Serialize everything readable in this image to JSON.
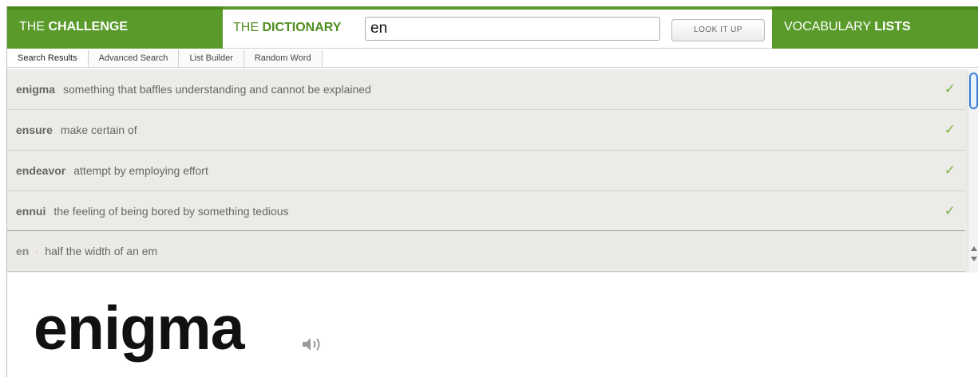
{
  "header": {
    "challenge": {
      "prefix": "THE ",
      "strong": "CHALLENGE"
    },
    "dictionary": {
      "prefix": "THE ",
      "strong": "DICTIONARY"
    },
    "search_value": "en",
    "lookup_label": "LOOK IT UP",
    "vocab": {
      "prefix": "VOCABULARY ",
      "strong": "LISTS"
    }
  },
  "tabs": [
    "Search Results",
    "Advanced Search",
    "List Builder",
    "Random Word"
  ],
  "results": [
    {
      "word": "enigma",
      "def": "something that baffles understanding and cannot be explained",
      "checked": true
    },
    {
      "word": "ensure",
      "def": "make certain of",
      "checked": true
    },
    {
      "word": "endeavor",
      "def": "attempt by employing effort",
      "checked": true
    },
    {
      "word": "ennui",
      "def": "the feeling of being bored by something tedious",
      "checked": true
    },
    {
      "word": "en",
      "def": "half the width of an em",
      "checked": false
    }
  ],
  "check_glyph": "✓",
  "headword": "enigma",
  "colors": {
    "brand_green": "#5a9a2b",
    "check_green": "#7cb342"
  }
}
